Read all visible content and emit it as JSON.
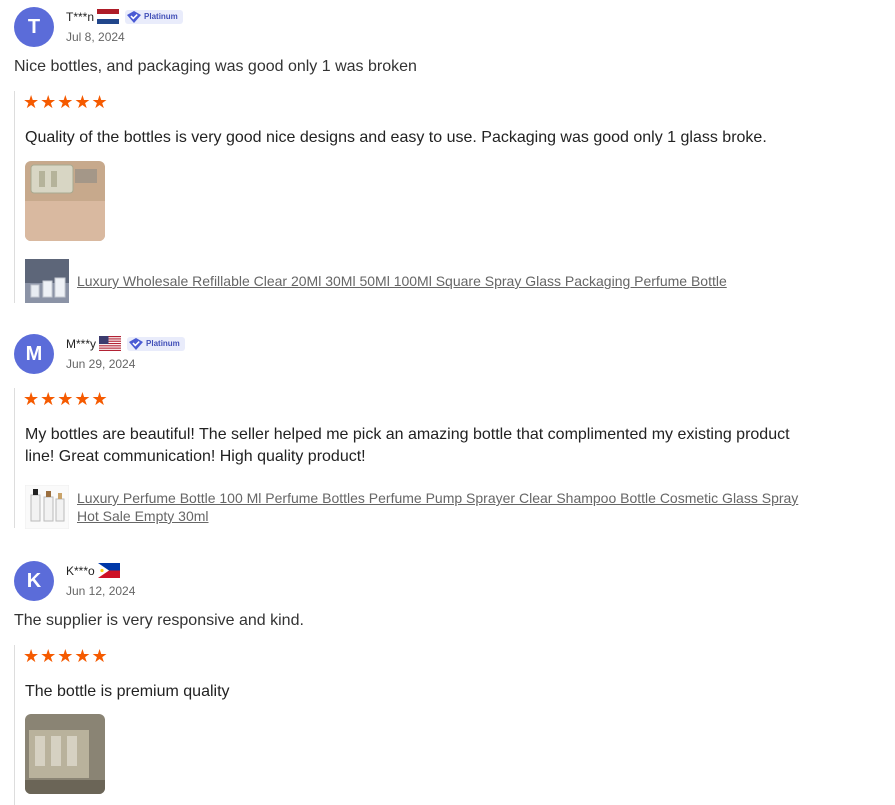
{
  "reviews": [
    {
      "initial": "T",
      "user": "T***n",
      "flag": "netherlands-flag",
      "badge": "Platinum",
      "date": "Jul 8, 2024",
      "summary": "Nice bottles, and packaging was good only 1 was broken",
      "rating": "★★★★★",
      "text": "Quality of the bottles is very good nice designs and easy to use. Packaging was good only 1 glass broke.",
      "product": "Luxury Wholesale Refillable Clear 20Ml 30Ml 50Ml 100Ml Square Spray Glass Packaging Perfume Bottle"
    },
    {
      "initial": "M",
      "user": "M***y",
      "flag": "usa-flag",
      "badge": "Platinum",
      "date": "Jun 29, 2024",
      "rating": "★★★★★",
      "text": "My bottles are beautiful! The seller helped me pick an amazing bottle that complimented my existing product line! Great communication! High quality product!",
      "product": "Luxury Perfume Bottle 100 Ml Perfume Bottles Perfume Pump Sprayer Clear Shampoo Bottle Cosmetic Glass Spray Hot Sale Empty 30ml"
    },
    {
      "initial": "K",
      "user": "K***o",
      "flag": "philippines-flag",
      "date": "Jun 12, 2024",
      "summary": "The supplier is very responsive and kind.",
      "rating": "★★★★★",
      "text": "The bottle is premium quality"
    }
  ]
}
